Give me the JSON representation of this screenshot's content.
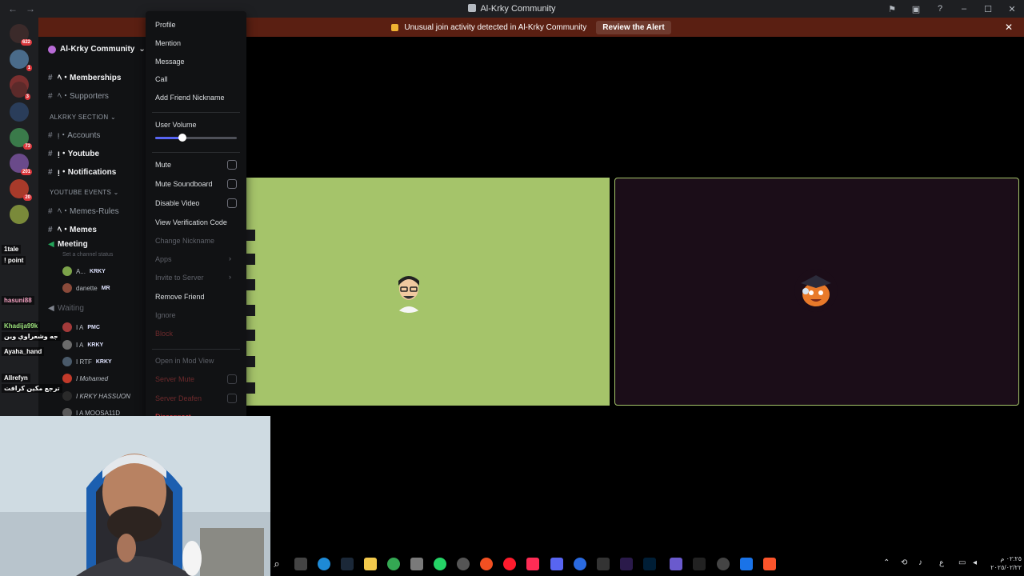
{
  "window": {
    "title": "Al-Krky Community",
    "nav_back": "←",
    "nav_forward": "→"
  },
  "alert": {
    "message": "Unusual join activity detected in Al-Krky Community",
    "action": "Review the Alert",
    "close": "✕"
  },
  "server_rail": {
    "badges": [
      "622",
      "1",
      "3",
      "73",
      "201",
      "20"
    ]
  },
  "sidebar": {
    "server_name": "Al-Krky Community",
    "channels": [
      {
        "label": "ﾍ・Memberships",
        "bright": true
      },
      {
        "label": "ﾍ・Supporters",
        "bright": false
      }
    ],
    "category_1": "ALKRKY SECTION",
    "channels_2": [
      {
        "label": "ᴉ・Accounts",
        "bright": false
      },
      {
        "label": "ᴉ・Youtube",
        "bright": true
      },
      {
        "label": "ᴉ・Notifications",
        "bright": true
      }
    ],
    "category_2": "YOUTUBE EVENTS",
    "channels_3": [
      {
        "label": "ﾍ・Memes-Rules",
        "bright": false
      },
      {
        "label": "ﾍ・Memes",
        "bright": true
      }
    ],
    "voice_meeting": "Meeting",
    "voice_status": "Set a channel status",
    "voice_waiting": "Waiting",
    "members": [
      {
        "name": "A...",
        "tag": "KRKY"
      },
      {
        "name": "danette",
        "tag": "MR"
      },
      {
        "name": "I A",
        "tag": "PMC"
      },
      {
        "name": "I A",
        "tag": "KRKY"
      },
      {
        "name": "I RTF",
        "tag": "KRKY"
      },
      {
        "name": "I Mohamed",
        "tag": ""
      },
      {
        "name": "I KRKY HASSUON",
        "tag": ""
      },
      {
        "name": "I A MOOSA11D",
        "tag": ""
      }
    ]
  },
  "stream_overlay": {
    "names": [
      "1tale",
      "! point",
      "hasuni88",
      "Khadija99k",
      "Ayaha_hand",
      "Allrefyn"
    ],
    "lines": [
      "ترجع مكين كرافت",
      "جه وشعراوي وين"
    ]
  },
  "context_menu": {
    "profile": "Profile",
    "mention": "Mention",
    "message": "Message",
    "call": "Call",
    "add_friend_nickname": "Add Friend Nickname",
    "user_volume": "User Volume",
    "user_volume_level": 0.33,
    "mute": "Mute",
    "mute_soundboard": "Mute Soundboard",
    "disable_video": "Disable Video",
    "view_verification_code": "View Verification Code",
    "change_nickname": "Change Nickname",
    "apps": "Apps",
    "invite_to_server": "Invite to Server",
    "remove_friend": "Remove Friend",
    "ignore": "Ignore",
    "block": "Block",
    "open_in_mod_view": "Open in Mod View",
    "server_mute": "Server Mute",
    "server_deafen": "Server Deafen",
    "disconnect": "Disconnect"
  },
  "taskbar": {
    "tray_lang": "ع",
    "clock_time": "٠٢:٢٥ م",
    "clock_date": "٢٠٢٥/٠٢/٢٢"
  },
  "colors": {
    "tile_green": "#a5c46a",
    "tile_dark": "#1b0d18",
    "alert_bg": "#5a1f12",
    "accent": "#5865f2",
    "danger": "#f23f43"
  }
}
